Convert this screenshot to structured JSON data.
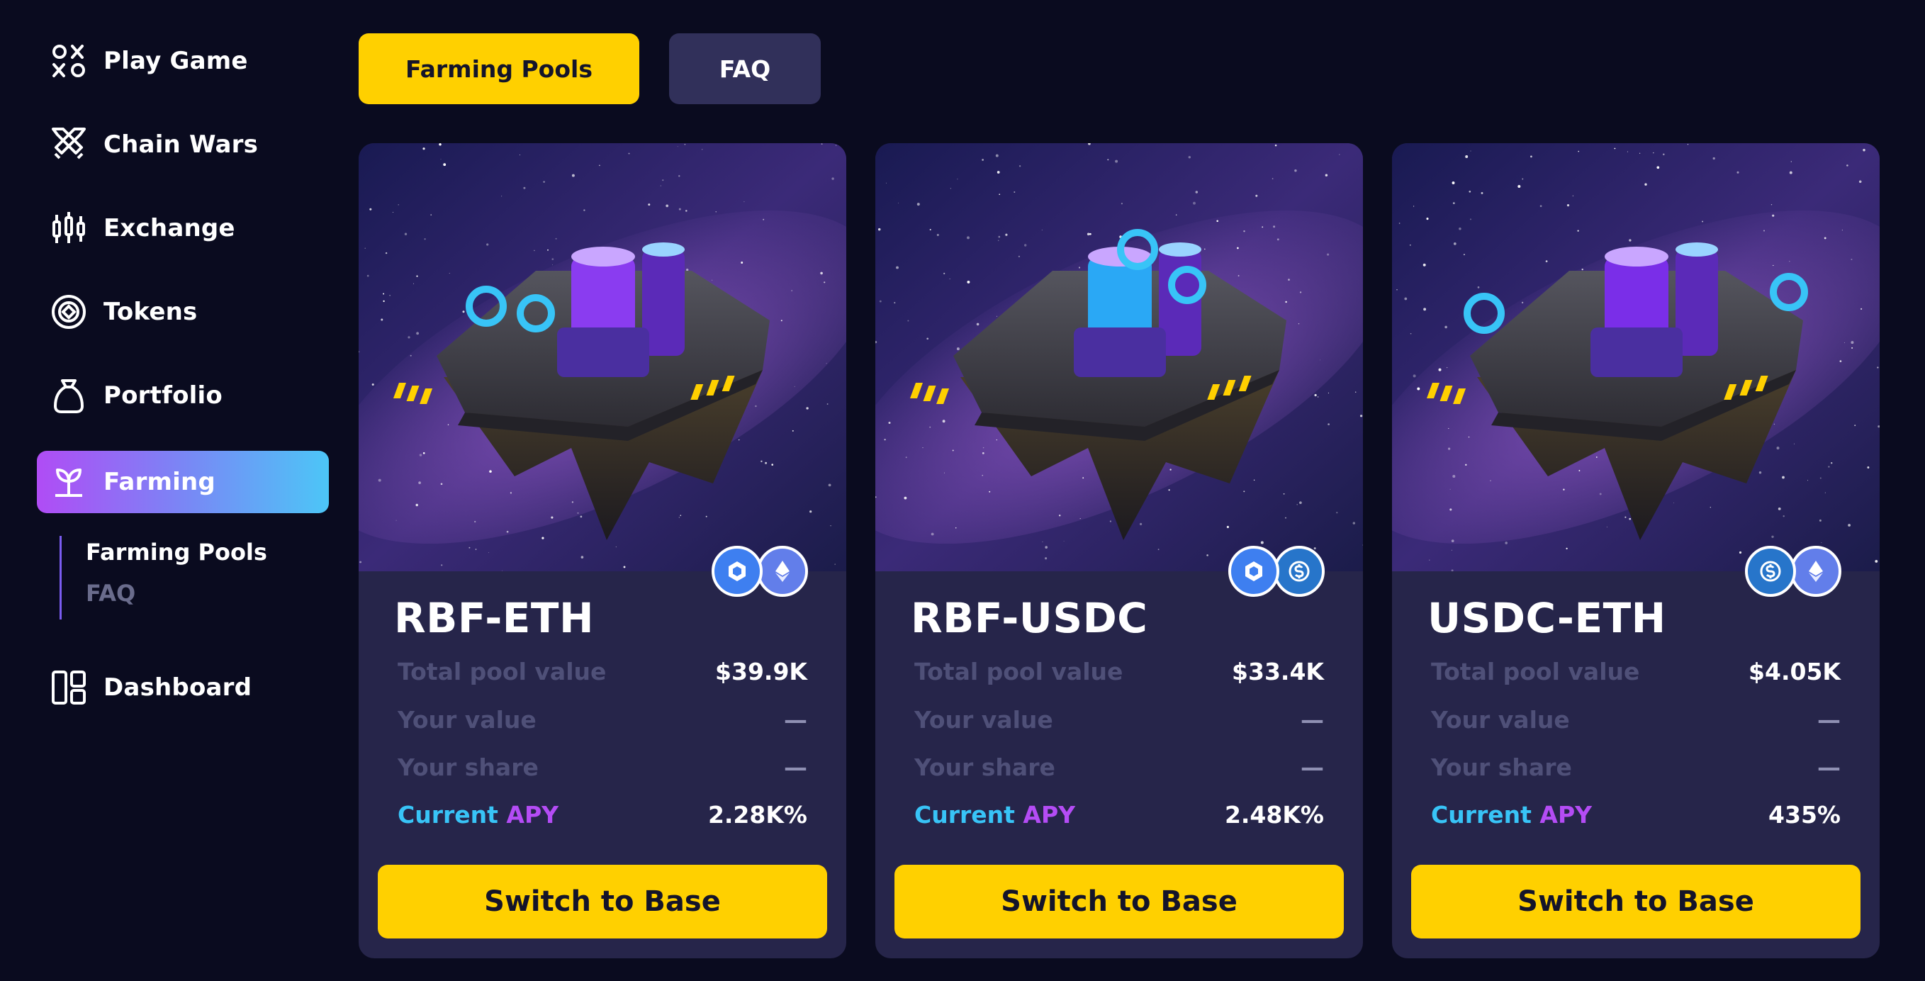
{
  "sidebar": {
    "items": [
      {
        "label": "Play Game",
        "icon": "xo-icon"
      },
      {
        "label": "Chain Wars",
        "icon": "crossed-swords-icon"
      },
      {
        "label": "Exchange",
        "icon": "candlestick-icon"
      },
      {
        "label": "Tokens",
        "icon": "token-coin-icon"
      },
      {
        "label": "Portfolio",
        "icon": "money-bag-icon"
      },
      {
        "label": "Farming",
        "icon": "leaf-icon"
      },
      {
        "label": "Dashboard",
        "icon": "dashboard-grid-icon"
      }
    ],
    "active": "Farming",
    "farming_sub": [
      "Farming Pools",
      "FAQ"
    ]
  },
  "tabs": {
    "farming_pools": "Farming Pools",
    "faq": "FAQ"
  },
  "labels": {
    "total_pool_value": "Total pool value",
    "your_value": "Your value",
    "your_share": "Your share",
    "current": "Current",
    "apy": "APY",
    "switch_button": "Switch to Base"
  },
  "pools": [
    {
      "name": "RBF-ETH",
      "total": "$39.9K",
      "your_value": "—",
      "your_share": "—",
      "apy": "2.28K%",
      "tokens": [
        "rbf",
        "eth"
      ]
    },
    {
      "name": "RBF-USDC",
      "total": "$33.4K",
      "your_value": "—",
      "your_share": "—",
      "apy": "2.48K%",
      "tokens": [
        "rbf",
        "usdc"
      ]
    },
    {
      "name": "USDC-ETH",
      "total": "$4.05K",
      "your_value": "—",
      "your_share": "—",
      "apy": "435%",
      "tokens": [
        "usdc",
        "eth"
      ]
    }
  ],
  "colors": {
    "accent_yellow": "#ffd000",
    "background": "#0a0b1f",
    "card": "#26254a",
    "apy_cyan": "#38c4f7",
    "apy_purple": "#b44cf5"
  }
}
